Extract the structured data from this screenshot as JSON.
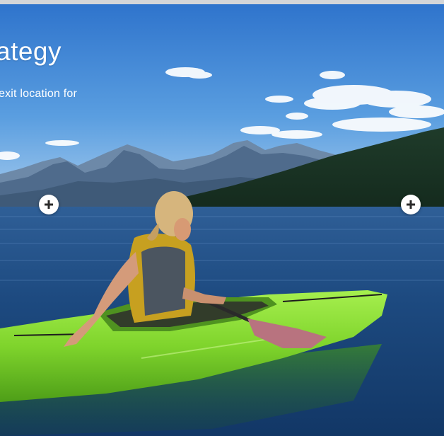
{
  "slide": {
    "headline": "ategy",
    "subtext": "exit location for"
  },
  "hotspots": [
    {
      "icon": "plus-icon"
    },
    {
      "icon": "plus-icon"
    }
  ],
  "colors": {
    "sky_top": "#3c7fd0",
    "sky_bottom": "#8fc0ea",
    "water": "#1c4e86",
    "kayak": "#7ad42a",
    "hotspot_bg": "#ffffff",
    "hotspot_icon": "#2b2b2b"
  }
}
